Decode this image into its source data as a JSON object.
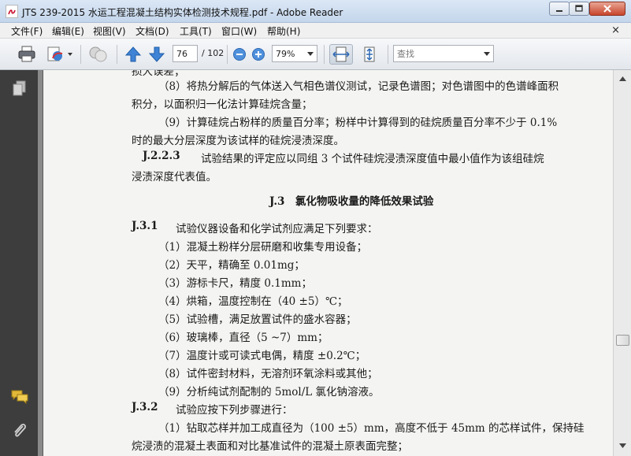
{
  "window": {
    "title": "JTS 239-2015 水运工程混凝土结构实体检测技术规程.pdf - Adobe Reader"
  },
  "menu": {
    "file": "文件(F)",
    "edit": "编辑(E)",
    "view": "视图(V)",
    "document": "文档(D)",
    "tools": "工具(T)",
    "window": "窗口(W)",
    "help": "帮助(H)",
    "close_glyph": "×"
  },
  "toolbar": {
    "current_page": "76",
    "page_total": "/ 102",
    "zoom": "79%",
    "search_placeholder": "查找",
    "icons": [
      "print-icon",
      "share-icon",
      "collaborate-icon",
      "prev-page-icon",
      "next-page-icon",
      "zoom-out-icon",
      "zoom-in-icon",
      "fit-width-icon",
      "fit-page-icon"
    ]
  },
  "nav": {
    "icons": [
      "pages-icon",
      "comments-icon",
      "attachments-icon"
    ]
  },
  "document": {
    "lines": [
      {
        "text": "损大误差；",
        "indent": 0
      },
      {
        "text": "（8）将热分解后的气体送入气相色谱仪测试，记录色谱图；对色谱图中的色谱峰面积",
        "indent": 1
      },
      {
        "text": "积分，以面积归一化法计算硅烷含量；",
        "indent": 0
      },
      {
        "text": "（9）计算硅烷占粉样的质量百分率；粉样中计算得到的硅烷质量百分率不少于 0.1%",
        "indent": 1
      },
      {
        "text": "时的最大分层深度为该试样的硅烷浸渍深度。",
        "indent": 0
      }
    ],
    "clause_223_num": "J.2.2.3",
    "clause_223_text": "试验结果的评定应以同组 3 个试件硅烷浸渍深度值中最小值作为该组硅烷",
    "clause_223_cont": "浸渍深度代表值。",
    "section_heading": "J.3　氯化物吸收量的降低效果试验",
    "clause_31_num": "J.3.1",
    "clause_31_text": "试验仪器设备和化学试剂应满足下列要求：",
    "items_31": [
      "（1）混凝土粉样分层研磨和收集专用设备；",
      "（2）天平，精确至 0.01mg；",
      "（3）游标卡尺，精度 0.1mm；",
      "（4）烘箱，温度控制在（40 ±5）℃；",
      "（5）试验槽，满足放置试件的盛水容器；",
      "（6）玻璃棒，直径（5 ~7）mm；",
      "（7）温度计或可读式电偶，精度 ±0.2℃；",
      "（8）试件密封材料，无溶剂环氧涂料或其他；",
      "（9）分析纯试剂配制的 5mol/L 氯化钠溶液。"
    ],
    "clause_32_num": "J.3.2",
    "clause_32_text": "试验应按下列步骤进行：",
    "items_32": [
      "（1）钻取芯样并加工成直径为（100 ±5）mm，高度不低于 45mm 的芯样试件，保持硅",
      "烷浸渍的混凝土表面和对比基准试件的混凝土原表面完整；"
    ]
  }
}
